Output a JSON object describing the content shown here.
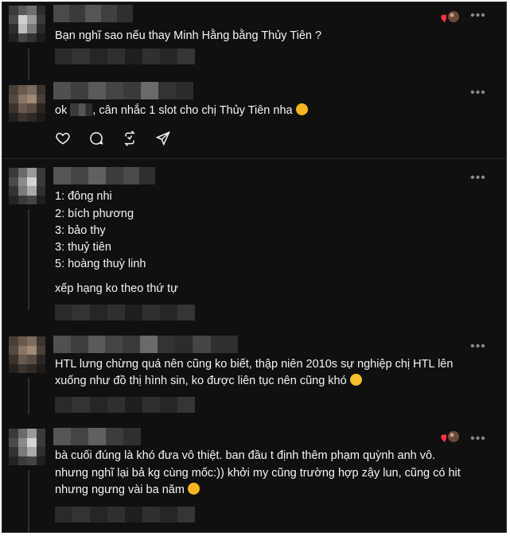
{
  "comments": [
    {
      "text": "Bạn nghĩ sao nếu thay Minh Hằng bằng Thủy Tiên ?"
    },
    {
      "text_before": "ok",
      "text_after": ", cân nhắc 1 slot cho chị Thủy Tiên nha"
    },
    {
      "lines": [
        "1: đông nhi",
        "2: bích phương",
        "3: bảo thy",
        "3: thuỷ tiên",
        "5: hoàng thuỳ linh"
      ],
      "note": "xếp hạng ko theo thứ tự"
    },
    {
      "lines": [
        "HTL lưng chừng quá nên cũng ko biết, thập niên 2010s sự nghiệp chị HTL lên",
        "xuống như đồ thị hình sin, ko được liên tục nên cũng khó"
      ]
    },
    {
      "lines": [
        "bà cuối đúng là khó đưa vô thiệt. ban đầu t định thêm phạm quỳnh anh vô.",
        "nhưng nghĩ lại bả kg cùng mốc:)) khởi my cũng trường hợp zậy lun, cũng có hit",
        "nhưng ngưng vài ba năm"
      ]
    }
  ],
  "icons": {
    "more": "more-options-icon",
    "like": "heart-icon",
    "reply": "comment-bubble-icon",
    "repost": "repost-icon",
    "share": "send-icon"
  },
  "more_glyph": "•••",
  "colors": {
    "background": "#101010",
    "text": "#f3f5f7",
    "muted": "#8a8a8a",
    "heart": "#ff3040"
  }
}
